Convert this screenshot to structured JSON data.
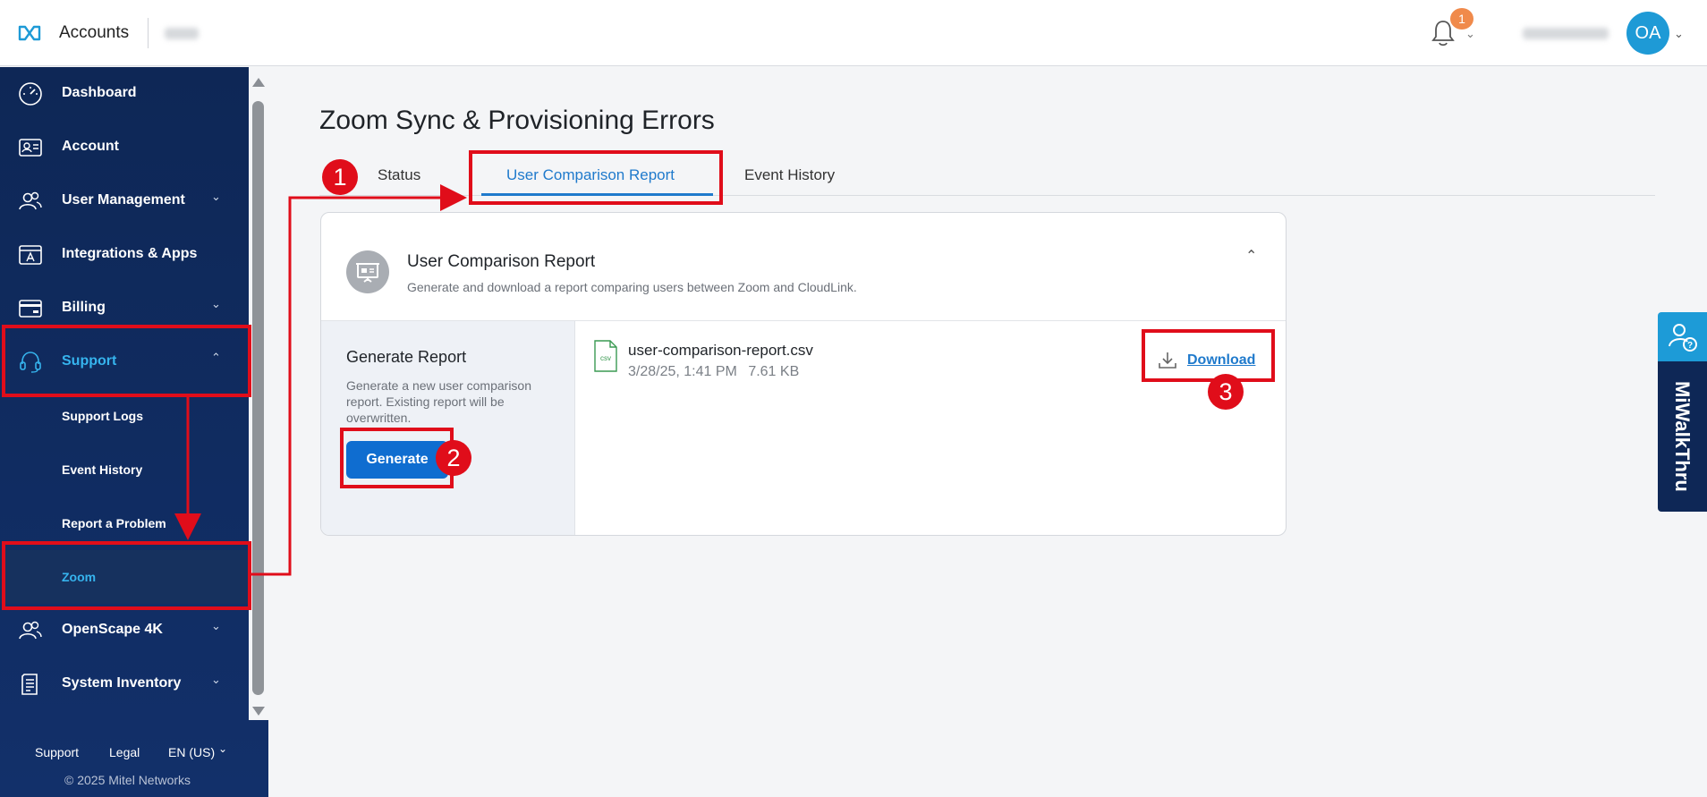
{
  "header": {
    "app_title": "Accounts",
    "notification_count": "1",
    "user_initials": "OA"
  },
  "sidebar": {
    "items": [
      {
        "label": "Dashboard",
        "icon": "dashboard-gauge-icon"
      },
      {
        "label": "Account",
        "icon": "id-card-icon"
      },
      {
        "label": "User Management",
        "icon": "users-icon",
        "expandable": true
      },
      {
        "label": "Integrations & Apps",
        "icon": "app-store-icon"
      },
      {
        "label": "Billing",
        "icon": "credit-card-icon",
        "expandable": true
      },
      {
        "label": "Support",
        "icon": "headset-icon",
        "expandable": true,
        "expanded": true,
        "active": true
      },
      {
        "label": "OpenScape 4K",
        "icon": "users-icon",
        "expandable": true
      },
      {
        "label": "System Inventory",
        "icon": "document-list-icon",
        "expandable": true
      }
    ],
    "support_subitems": [
      {
        "label": "Support Logs"
      },
      {
        "label": "Event History"
      },
      {
        "label": "Report a Problem"
      },
      {
        "label": "Zoom",
        "active": true
      }
    ],
    "footer": {
      "support": "Support",
      "legal": "Legal",
      "language": "EN (US)",
      "copyright": "© 2025 Mitel Networks"
    }
  },
  "main": {
    "page_title": "Zoom Sync & Provisioning Errors",
    "tabs": [
      {
        "label": "Status"
      },
      {
        "label": "User Comparison Report",
        "active": true
      },
      {
        "label": "Event History"
      }
    ],
    "card": {
      "title": "User Comparison Report",
      "subtitle": "Generate and download a report comparing users between Zoom and CloudLink.",
      "generate_title": "Generate Report",
      "generate_desc": "Generate a new user comparison report. Existing report will be overwritten.",
      "generate_button": "Generate",
      "file_icon_label": "csv",
      "file_name": "user-comparison-report.csv",
      "file_date": "3/28/25, 1:41 PM",
      "file_size": "7.61 KB",
      "download_label": "Download"
    }
  },
  "walkthrough": {
    "label": "MiWalkThru"
  },
  "annotations": {
    "step1": "1",
    "step2": "2",
    "step3": "3"
  },
  "colors": {
    "sidebar_bg": "#0e2756",
    "accent": "#1f7acc",
    "active_nav": "#36b4ee",
    "primary_button": "#0f6dd0",
    "annotation_red": "#e00d1a",
    "notification_badge": "#f08a4b",
    "avatar": "#1e9ad6"
  }
}
